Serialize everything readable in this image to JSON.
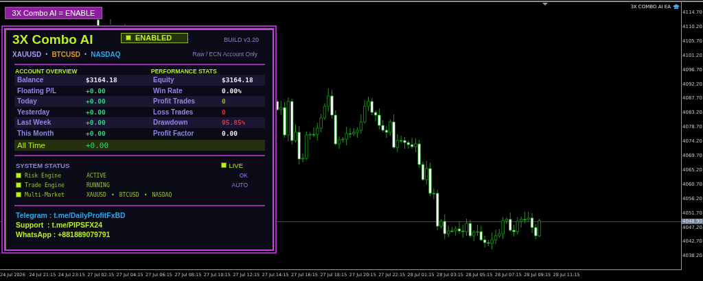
{
  "toggle_button": {
    "label": "3X Combo AI = ENABLE"
  },
  "chart": {
    "indicator_label": "3X COMBO AI EA",
    "price_axis": [
      "4114.70",
      "4110.20",
      "4105.70",
      "4101.20",
      "4096.70",
      "4092.20",
      "4087.70",
      "4083.20",
      "4078.70",
      "4074.20",
      "4069.70",
      "4065.20",
      "4060.70",
      "4056.20",
      "4051.70",
      "4047.20",
      "4042.70",
      "4038.20"
    ],
    "current_price": "4048.90",
    "time_axis": [
      "24 Jul 2026",
      "24 Jul 21:15",
      "24 Jul 23:15",
      "27 Jul 02:15",
      "27 Jul 04:15",
      "27 Jul 06:15",
      "27 Jul 08:15",
      "27 Jul 10:15",
      "27 Jul 12:15",
      "27 Jul 14:15",
      "27 Jul 16:15",
      "27 Jul 18:15",
      "27 Jul 20:15",
      "27 Jul 22:15",
      "28 Jul 01:15",
      "28 Jul 03:15",
      "28 Jul 05:15",
      "28 Jul 07:15",
      "28 Jul 09:15",
      "28 Jul 11:15"
    ]
  },
  "panel": {
    "title": "3X Combo AI",
    "status_badge": {
      "label": "ENABLED"
    },
    "build": "BUILD v3.20",
    "symbols": [
      {
        "name": "XAUUSD",
        "color": "#a898f0"
      },
      {
        "name": "BTCUSD",
        "color": "#e0961e"
      },
      {
        "name": "NASDAQ",
        "color": "#2fa6e8"
      }
    ],
    "separator": "•",
    "account_note": "Raw / ECN Account Only",
    "account_overview": {
      "heading": "ACCOUNT OVERVIEW",
      "rows": [
        {
          "label": "Balance",
          "value": "$3164.18",
          "color": "#e8e8f0"
        },
        {
          "label": "Floating P/L",
          "value": "+0.00",
          "color": "#2ed27a"
        },
        {
          "label": "Today",
          "value": "+0.00",
          "color": "#2ed27a"
        },
        {
          "label": "Yesterday",
          "value": "+0.00",
          "color": "#2ed27a"
        },
        {
          "label": "Last Week",
          "value": "+0.00",
          "color": "#2ed27a"
        },
        {
          "label": "This Month",
          "value": "+0.00",
          "color": "#2ed27a"
        }
      ]
    },
    "performance_stats": {
      "heading": "PERFORMANCE STATS",
      "rows": [
        {
          "label": "Equity",
          "value": "$3164.18",
          "color": "#e8e8f0"
        },
        {
          "label": "Win Rate",
          "value": "0.00%",
          "color": "#e8e8f0"
        },
        {
          "label": "Profit Trades",
          "value": "0",
          "color": "#8fb034"
        },
        {
          "label": "Loss Trades",
          "value": "0",
          "color": "#e0303c"
        },
        {
          "label": "Drawdown",
          "value": "95.85%",
          "color": "#e0304c"
        },
        {
          "label": "Profit Factor",
          "value": "0.00",
          "color": "#e8e8f0"
        }
      ]
    },
    "all_time": {
      "label": "All Time",
      "value": "+0.00"
    },
    "system_status": {
      "heading": "SYSTEM STATUS",
      "live_label": "LIVE",
      "items": [
        {
          "kind": "state",
          "name": "Risk Engine",
          "value": "ACTIVE",
          "note": "OK"
        },
        {
          "kind": "state",
          "name": "Trade Engine",
          "value": "RUNNING",
          "note": "AUTO"
        },
        {
          "kind": "markets",
          "name": "Multi-Market",
          "markets": [
            "XAUUSD",
            "BTCUSD",
            "NASDAQ"
          ]
        }
      ]
    },
    "contacts": [
      {
        "text": "Telegram : t.me/DailyProfitFxBD",
        "color": "#2fa6e8"
      },
      {
        "text": "Support  : t.me/PIPSFX24",
        "color": "#b8f020"
      },
      {
        "text": "WhatsApp : +881889079791",
        "color": "#b8f020"
      }
    ]
  }
}
